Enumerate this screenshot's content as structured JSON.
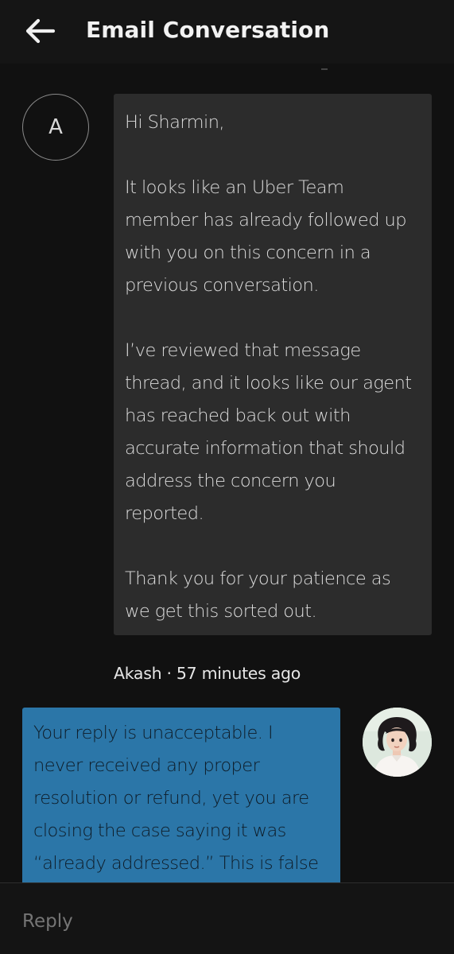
{
  "header": {
    "title": "Email Conversation",
    "back_icon": "arrow-left-icon"
  },
  "colors": {
    "background": "#111111",
    "agent_bubble": "#2c2c2c",
    "user_bubble": "#2b76a8",
    "text": "#e8e8e8"
  },
  "agent_message": {
    "avatar_letter": "A",
    "lines": [
      "Hi Sharmin,",
      "",
      "It looks like an Uber Team",
      "member has already followed up",
      "with you on this concern in a",
      "previous conversation.",
      "",
      "I’ve reviewed that message",
      "thread, and it looks like our agent",
      "has reached back out with",
      "accurate information that should",
      "address the concern you",
      "reported.",
      "",
      "Thank you for your patience as",
      "we get this sorted out."
    ],
    "meta": "Akash · 57 minutes ago"
  },
  "user_message": {
    "avatar_icon": "user-avatar-illustration",
    "lines": [
      "Your reply is unacceptable. I",
      "never received any proper",
      "resolution or refund, yet you are",
      "closing the case saying it was",
      "“already addressed.” This is false"
    ]
  },
  "reply": {
    "placeholder": "Reply"
  }
}
